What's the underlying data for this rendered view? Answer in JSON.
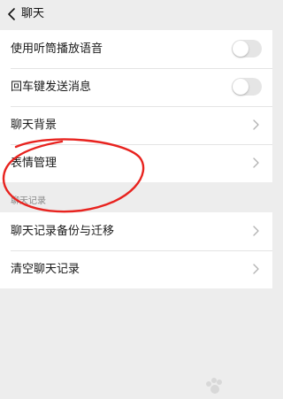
{
  "header": {
    "back_icon": "chevron-left-icon",
    "title": "聊天"
  },
  "settings": {
    "rows": [
      {
        "label": "使用听筒播放语音",
        "control": "toggle",
        "on": false
      },
      {
        "label": "回车键发送消息",
        "control": "toggle",
        "on": false
      },
      {
        "label": "聊天背景",
        "control": "chevron-right-icon"
      },
      {
        "label": "表情管理",
        "control": "chevron-right-icon"
      }
    ]
  },
  "chat_records": {
    "section_label": "聊天记录",
    "rows": [
      {
        "label": "聊天记录备份与迁移",
        "control": "chevron-right-icon"
      },
      {
        "label": "清空聊天记录",
        "control": "chevron-right-icon"
      }
    ]
  },
  "colors": {
    "background": "#ededed",
    "card": "#ffffff",
    "annotation": "#e8231f",
    "toggle_off": "#e5e5e5"
  }
}
